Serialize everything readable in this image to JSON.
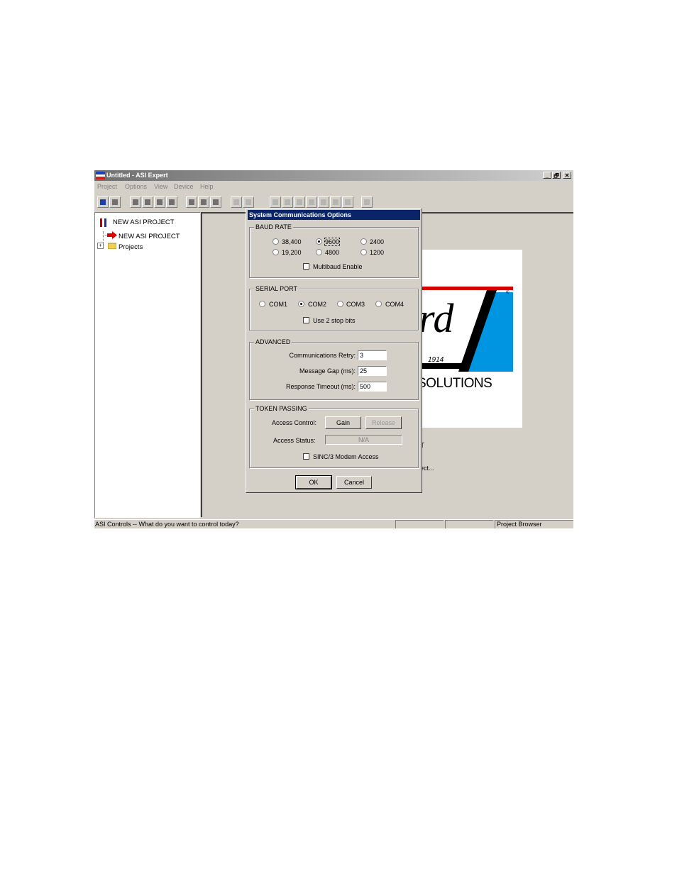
{
  "window": {
    "title": "Untitled - ASI Expert",
    "minimize": "_",
    "restore": "🗗",
    "close": "✕"
  },
  "menu": [
    "Project",
    "Options",
    "View",
    "Device",
    "Help"
  ],
  "toolbar": {
    "icons": [
      "monitor-icon",
      "tools-icon",
      "open-icon",
      "print-icon",
      "find-icon",
      "upload-icon",
      "save-icon",
      "save-all-icon",
      "save-as-icon",
      "download-icon",
      "download-all-icon",
      "home-icon",
      "text-icon",
      "panel-icon",
      "monitor2-icon",
      "grid-icon",
      "table-icon",
      "chart-icon",
      "check-icon"
    ]
  },
  "tree": {
    "root": "NEW ASI PROJECT",
    "child": "NEW ASI PROJECT",
    "folder": "Projects",
    "expander": "+"
  },
  "background": {
    "logo_text_top": "rd",
    "logo_year": "1914",
    "logo_solutions": "SOLUTIONS",
    "logo_reg": "®",
    "partial_text_1": "T",
    "partial_text_2": "ect..."
  },
  "dialog": {
    "title": "System Communications Options",
    "baud": {
      "title": "BAUD RATE",
      "options": [
        "38,400",
        "9600",
        "2400",
        "19,200",
        "4800",
        "1200"
      ],
      "selected": "9600",
      "multibaud_label": "Multibaud Enable"
    },
    "serial": {
      "title": "SERIAL PORT",
      "options": [
        "COM1",
        "COM2",
        "COM3",
        "COM4"
      ],
      "selected": "COM2",
      "stopbits_label": "Use 2 stop bits"
    },
    "advanced": {
      "title": "ADVANCED",
      "retry_label": "Communications Retry:",
      "retry_value": "3",
      "gap_label": "Message Gap (ms):",
      "gap_value": "25",
      "timeout_label": "Response Timeout (ms):",
      "timeout_value": "500"
    },
    "token": {
      "title": "TOKEN PASSING",
      "access_control_label": "Access Control:",
      "gain_button": "Gain",
      "release_button": "Release",
      "access_status_label": "Access Status:",
      "access_status_value": "N/A",
      "sinc_label": "SINC/3 Modem Access"
    },
    "ok_button": "OK",
    "cancel_button": "Cancel"
  },
  "status": {
    "message": "ASI Controls -- What do you want to control today?",
    "pane2": "",
    "pane3": "",
    "pane4": "Project Browser"
  },
  "colors": {
    "dialog_title_bg": "#0a246a",
    "logo_blue": "#0095e0",
    "logo_red": "#d40000"
  }
}
